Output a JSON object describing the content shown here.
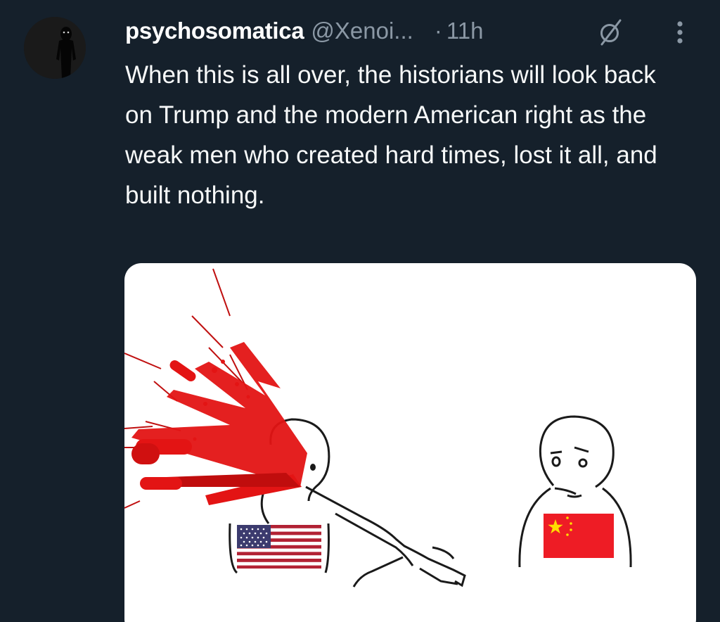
{
  "post": {
    "author": {
      "display_name": "psychosomatica",
      "handle": "@Xenoi...",
      "avatar_icon": "dark-figure-avatar"
    },
    "separator": "·",
    "timestamp": "11h",
    "text": "When this is all over, the historians will look back on Trump and the modern American right as the weak men who created hard times, lost it all, and built nothing.",
    "icons": {
      "grok": "slashed-circle-icon",
      "more": "more-options-icon"
    },
    "media": {
      "type": "cartoon-image",
      "colors": {
        "blood": "#e31414",
        "flag_china_red": "#ee1c25",
        "flag_china_star": "#ffde00",
        "flag_us_red": "#b22234",
        "flag_us_blue": "#3c3b6e"
      }
    }
  },
  "theme": {
    "background": "#15202b",
    "text_primary": "#f7f9f9",
    "text_secondary": "#8b98a5"
  }
}
